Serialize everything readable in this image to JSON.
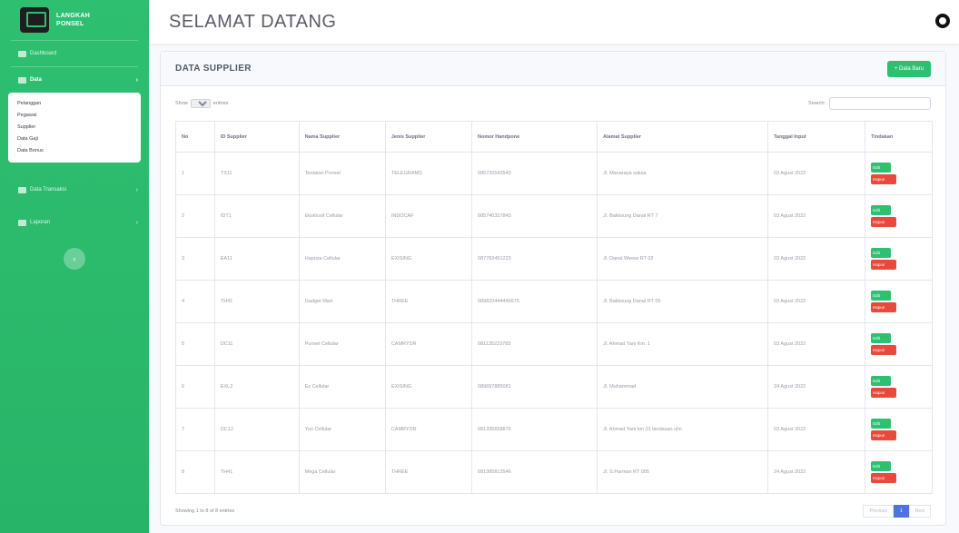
{
  "brand": {
    "line1": "LANGKAH",
    "line2": "PONSEL"
  },
  "sidebar": {
    "dashboard": "Dashboard",
    "data": "Data",
    "submenu": [
      "Pelanggan",
      "Pegawai",
      "Supplier",
      "Data Gaji",
      "Data Bonus"
    ],
    "transaksi": "Data Transaksi",
    "laporan": "Laporan",
    "toggle_icon": "‹"
  },
  "header": {
    "title": "SELAMAT DATANG"
  },
  "card": {
    "title": "DATA SUPPLIER",
    "add_button": "+ Data Baru"
  },
  "controls": {
    "show": "Show",
    "entries_value": "10",
    "entries": "entries",
    "search": "Search:"
  },
  "table": {
    "headers": [
      "No",
      "ID Supplier",
      "Nama Supplier",
      "Jenis Supplier",
      "Nomor Handpone",
      "Alamat Supplier",
      "Tanggal Input",
      "Tindakan"
    ],
    "rows": [
      [
        "1",
        "TS11",
        "Tentalan Ponsel",
        "TELEGRAMS",
        "085720543543",
        "Jl. Manaraya saksa",
        "03 Agust 2022"
      ],
      [
        "2",
        "IDT1",
        "Eksklusif Cellular",
        "INDOCAF",
        "085740327843",
        "Jl. Bakksung Danal RT 7",
        "03 Agust 2022"
      ],
      [
        "3",
        "EA11",
        "Hapusa Cellular",
        "EXISING",
        "087783451223",
        "Jl. Danal Wwwa RT 02",
        "03 Agust 2022"
      ],
      [
        "4",
        "TH41",
        "Gadget Mart",
        "THREE",
        "089820444446675",
        "Jl. Bakksung Danal RT 05",
        "03 Agust 2022"
      ],
      [
        "5",
        "DC11",
        "Ponsel Cellular",
        "CAMRYDR",
        "081135223783",
        "Jl. Ahmad Yani Km. 1",
        "03 Agust 2022"
      ],
      [
        "6",
        "EXL2",
        "Ez Cellular",
        "EXISING",
        "089697885081",
        "Jl. Muhammad",
        "24 Agust 2022"
      ],
      [
        "7",
        "DC12",
        "Yoo Cellular",
        "CAMRYDR",
        "081335658876",
        "Jl. Ahmad Yani km 21 landasan ulin",
        "03 Agust 2022"
      ],
      [
        "8",
        "TH41",
        "Mega Cellular",
        "THREE",
        "081385813546",
        "Jl. S.Parman RT 005",
        "24 Agust 2022"
      ]
    ],
    "edit_label": "Edit",
    "delete_label": "Hapus"
  },
  "footer": {
    "info": "Showing 1 to 8 of 8 entries",
    "previous": "Previous",
    "page": "1",
    "next": "Next"
  }
}
